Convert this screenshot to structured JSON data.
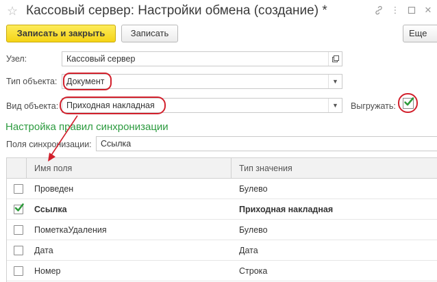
{
  "window": {
    "title": "Кассовый сервер: Настройки обмена (создание) *"
  },
  "icons": {
    "favorite": "star-icon",
    "link": "link-icon",
    "menu": "more-vertical-icon",
    "maximize": "maximize-icon",
    "close": "close-icon"
  },
  "toolbar": {
    "save_close_label": "Записать и закрыть",
    "save_label": "Записать",
    "more_label": "Еще"
  },
  "form": {
    "node_label": "Узел:",
    "node_value": "Кассовый сервер",
    "object_type_label": "Тип объекта:",
    "object_type_value": "Документ",
    "object_kind_label": "Вид объекта:",
    "object_kind_value": "Приходная накладная",
    "export_label": "Выгружать:",
    "export_checked": true
  },
  "sync": {
    "section_title": "Настройка правил синхронизации",
    "fields_label": "Поля синхронизации:",
    "fields_value": "Ссылка"
  },
  "table": {
    "columns": [
      "Имя поля",
      "Тип значения"
    ],
    "rows": [
      {
        "checked": false,
        "name": "Проведен",
        "type": "Булево",
        "bold": false
      },
      {
        "checked": true,
        "name": "Ссылка",
        "type": "Приходная накладная",
        "bold": true
      },
      {
        "checked": false,
        "name": "ПометкаУдаления",
        "type": "Булево",
        "bold": false
      },
      {
        "checked": false,
        "name": "Дата",
        "type": "Дата",
        "bold": false
      },
      {
        "checked": false,
        "name": "Номер",
        "type": "Строка",
        "bold": false
      }
    ]
  },
  "colors": {
    "accent_yellow": "#f5d416",
    "section_green": "#2b9a3e",
    "annotation_red": "#d21f2b",
    "check_green": "#2e9b3b"
  }
}
